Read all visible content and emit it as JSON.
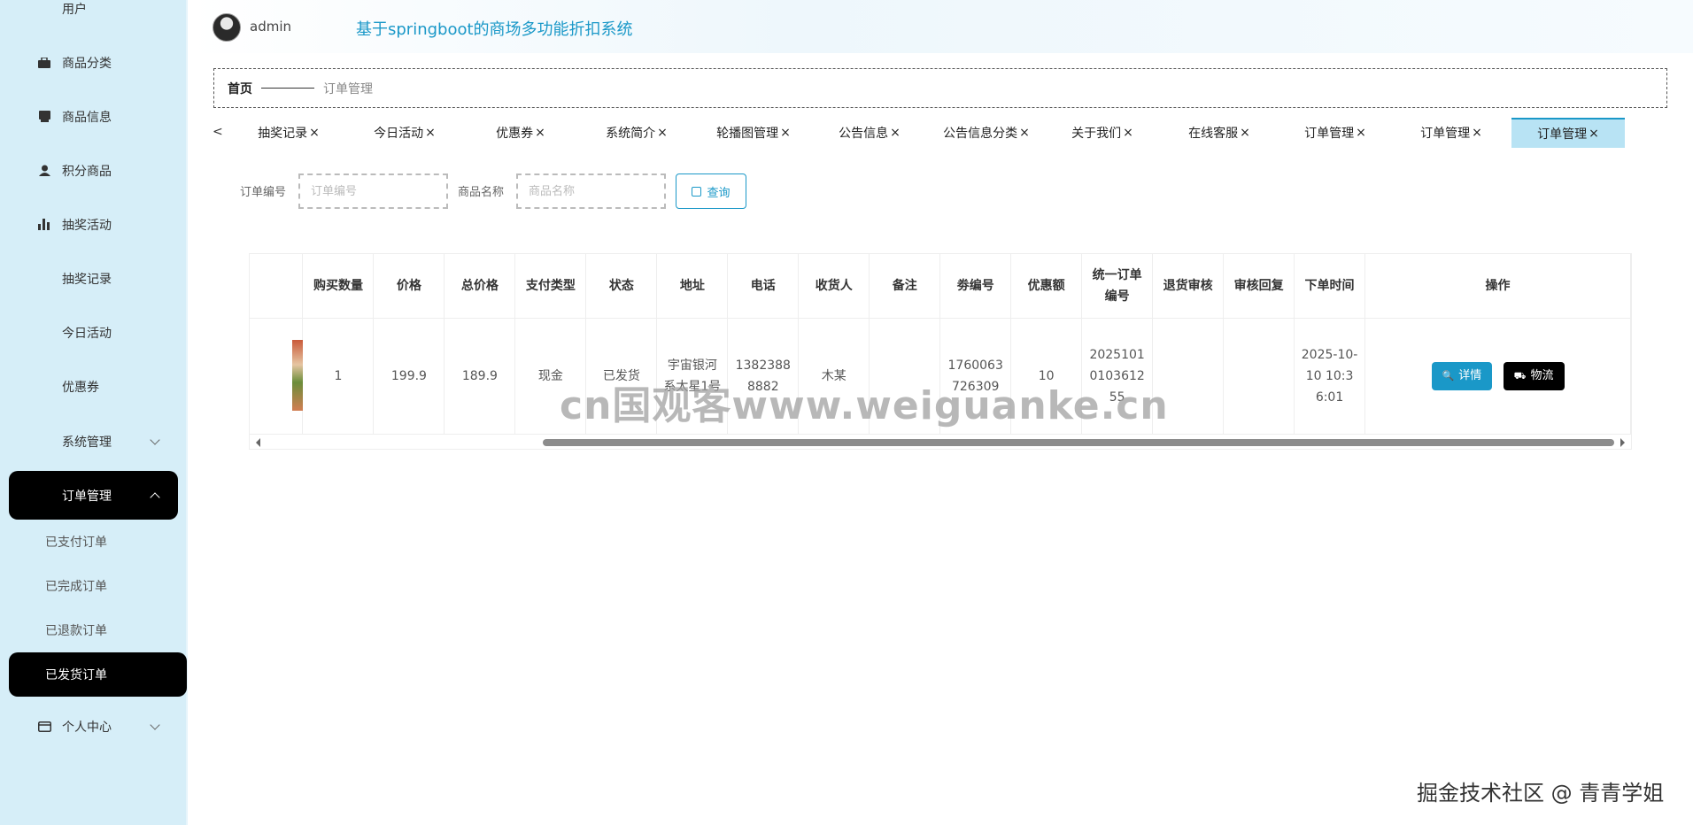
{
  "header": {
    "username": "admin",
    "system_title": "基于springboot的商场多功能折扣系统"
  },
  "sidebar": {
    "items": [
      {
        "label": "用户",
        "icon": "grid-icon"
      },
      {
        "label": "商品分类",
        "icon": "briefcase-icon"
      },
      {
        "label": "商品信息",
        "icon": "book-icon"
      },
      {
        "label": "积分商品",
        "icon": "user-icon"
      },
      {
        "label": "抽奖活动",
        "icon": "bar-chart-icon"
      },
      {
        "label": "抽奖记录",
        "icon": "grid-icon"
      },
      {
        "label": "今日活动",
        "icon": "grid-icon"
      },
      {
        "label": "优惠券",
        "icon": "grid-icon"
      },
      {
        "label": "系统管理",
        "icon": "grid-icon"
      },
      {
        "label": "订单管理",
        "icon": "grid-icon"
      }
    ],
    "sub_items": [
      "已支付订单",
      "已完成订单",
      "已退款订单",
      "已发货订单"
    ],
    "personal": "个人中心"
  },
  "breadcrumb": {
    "home": "首页",
    "current": "订单管理"
  },
  "tabs": {
    "scroll_left": "<",
    "close_glyph": "×",
    "items": [
      "抽奖记录",
      "今日活动",
      "优惠券",
      "系统简介",
      "轮播图管理",
      "公告信息",
      "公告信息分类",
      "关于我们",
      "在线客服",
      "订单管理",
      "订单管理",
      "订单管理"
    ],
    "active_index": 11
  },
  "search": {
    "order_no_label": "订单编号",
    "order_no_placeholder": "订单编号",
    "product_name_label": "商品名称",
    "product_name_placeholder": "商品名称",
    "query_button": "查询"
  },
  "table": {
    "columns": [
      "购买数量",
      "价格",
      "总价格",
      "支付类型",
      "状态",
      "地址",
      "电话",
      "收货人",
      "备注",
      "劵编号",
      "优惠额",
      "统一订单编号",
      "退货审核",
      "审核回复",
      "下单时间",
      "操作"
    ],
    "rows": [
      {
        "quantity": "1",
        "price": "199.9",
        "total": "189.9",
        "pay_type": "现金",
        "status": "已发货",
        "address": "宇宙银河系太星1号",
        "phone": "13823888882",
        "receiver": "木某",
        "remark": "",
        "coupon_no": "1760063726309",
        "discount": "10",
        "unified_no": "20251010103612 55",
        "return_review": "",
        "review_reply": "",
        "order_time": "2025-10-10 10:36:01",
        "detail_button": "详情",
        "logistics_button": "物流"
      }
    ]
  },
  "watermarks": {
    "center": "cn国观客www.weiguanke.cn",
    "corner": "掘金技术社区 @ 青青学姐"
  }
}
